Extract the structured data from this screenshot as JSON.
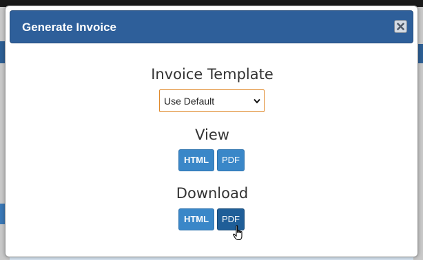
{
  "modal": {
    "title": "Generate Invoice",
    "close_icon": "close-icon"
  },
  "template_section": {
    "title": "Invoice Template",
    "select_value": "Use Default"
  },
  "view_section": {
    "title": "View",
    "html_label": "HTML",
    "pdf_label": "PDF"
  },
  "download_section": {
    "title": "Download",
    "html_label": "HTML",
    "pdf_label": "PDF"
  },
  "colors": {
    "header_bg": "#2e5f9a",
    "button_bg": "#3a87c8",
    "button_hover_bg": "#1f5e98",
    "select_border": "#e08a2c"
  },
  "cursor_icon": "hand-pointer-icon"
}
